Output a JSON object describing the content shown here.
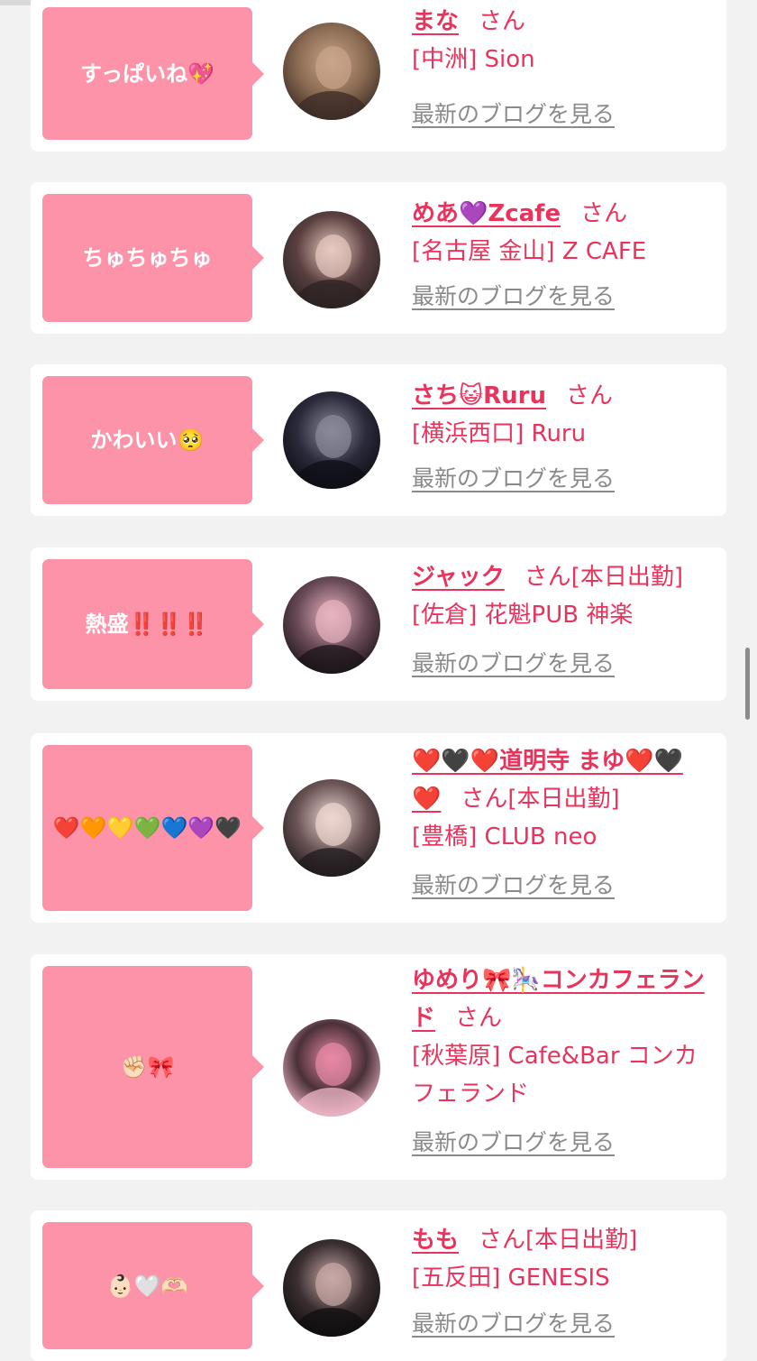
{
  "cards": [
    {
      "bubble": "すっぱいね💖",
      "name": "まな",
      "san": "さん",
      "attend": "",
      "shop": "[中洲] Sion",
      "blog": "最新のブログを見る",
      "avatar_colors": [
        "#3a2a25",
        "#c9a58a",
        "#8a6a52"
      ],
      "avatar_icon": "profile-photo"
    },
    {
      "bubble": "ちゅちゅちゅ",
      "name": "めあ💜Zcafe",
      "san": "さん",
      "attend": "",
      "shop": "[名古屋 金山] Z CAFE",
      "blog": "最新のブログを見る",
      "avatar_colors": [
        "#2b2222",
        "#e7c9c0",
        "#5a4040"
      ],
      "avatar_icon": "profile-photo"
    },
    {
      "bubble": "かわいい🥺",
      "name": "さち😺Ruru",
      "san": "さん",
      "attend": "",
      "shop": "[横浜西口] Ruru",
      "blog": "最新のブログを見る",
      "avatar_colors": [
        "#0d0d14",
        "#8a8a9a",
        "#2a2a3a"
      ],
      "avatar_icon": "profile-photo"
    },
    {
      "bubble": "熱盛‼️‼️‼️",
      "name": "ジャック",
      "san": "さん",
      "attend": "[本日出勤]",
      "shop": "[佐倉] 花魁PUB 神楽",
      "blog": "最新のブログを見る",
      "avatar_colors": [
        "#1a1418",
        "#e8b5c0",
        "#6a4a58"
      ],
      "avatar_icon": "profile-photo"
    },
    {
      "bubble": "❤️🧡💛💚💙💜🖤",
      "name": "❤️🖤❤️道明寺 まゆ❤️🖤❤️",
      "san": "さん",
      "attend": "[本日出勤]",
      "shop": "[豊橋] CLUB neo",
      "blog": "最新のブログを見る",
      "avatar_colors": [
        "#1e1a1c",
        "#efd7d2",
        "#6b5556"
      ],
      "avatar_icon": "profile-photo"
    },
    {
      "bubble": "✊🏻🎀",
      "name": "ゆめり🎀🎠コンカフェランド",
      "san": "さん",
      "attend": "",
      "shop": "[秋葉原] Cafe&Bar コンカフェランド",
      "blog": "最新のブログを見る",
      "avatar_colors": [
        "#f0b8c8",
        "#e88aa6",
        "#4a3038"
      ],
      "avatar_icon": "profile-photo"
    },
    {
      "bubble": "👶🏻🤍🫶🏻",
      "name": "もも",
      "san": "さん",
      "attend": "[本日出勤]",
      "shop": "[五反田] GENESIS",
      "blog": "最新のブログを見る",
      "avatar_colors": [
        "#0f0d0e",
        "#c9aaa8",
        "#3a2e30"
      ],
      "avatar_icon": "profile-photo"
    }
  ],
  "colors": {
    "accent": "#e8345c",
    "bubble": "#fd93a8",
    "link_gray": "#8a8a8a",
    "background": "#f2f2f2"
  }
}
